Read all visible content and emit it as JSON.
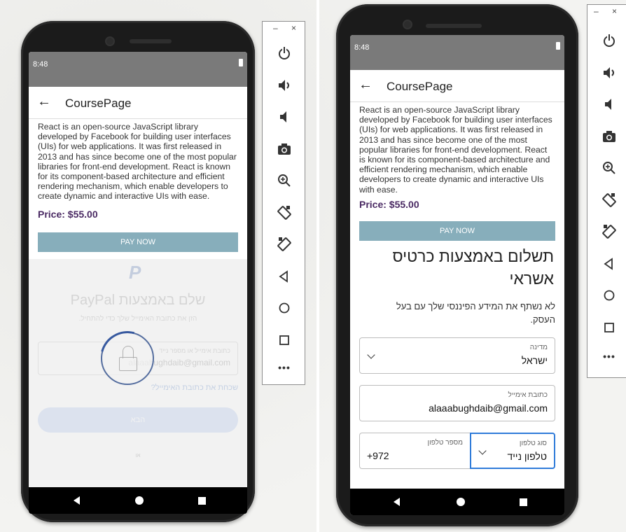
{
  "status": {
    "time": "8:48"
  },
  "appbar": {
    "back_glyph": "←",
    "title": "CoursePage"
  },
  "course": {
    "description": "React is an open-source JavaScript library developed by Facebook for building user interfaces (UIs) for web applications. It was first released in 2013 and has since become one of the most popular libraries for front-end development. React is known for its component-based architecture and efficient rendering mechanism, which enable developers to create dynamic and interactive UIs with ease.",
    "price": "Price: $55.00",
    "pay_button": "PAY NOW"
  },
  "paypal": {
    "logo": "P",
    "title": "שלם באמצעות PayPal",
    "subtitle": "הזן את כתובת האימייל שלך כדי להתחיל.",
    "email_label": "כתובת אימייל או מספר נייד",
    "email_value": "alaaabughdaib@gmail.com",
    "forgot_link": "שכחת את כתובת האימייל?",
    "next_button": "הבא",
    "or_text": "או"
  },
  "card_form": {
    "title": "תשלום באמצעות כרטיס אשראי",
    "note": "לא נשתף את המידע הפיננסי שלך עם בעל העסק.",
    "country_label": "מדינה",
    "country_value": "ישראל",
    "email_label": "כתובת אימייל",
    "email_value": "alaaabughdaib@gmail.com",
    "phone_type_label": "סוג טלפון",
    "phone_type_value": "טלפון נייד",
    "phone_number_label": "מספר טלפון",
    "phone_number_value": "+972"
  },
  "emulator_panel": {
    "window_controls": "– ×",
    "more_label": "•••",
    "buttons": [
      "power-icon",
      "volume-up-icon",
      "volume-down-icon",
      "camera-icon",
      "zoom-icon",
      "rotate-left-icon",
      "rotate-right-icon",
      "back-icon",
      "home-icon",
      "overview-icon"
    ]
  },
  "colors": {
    "accent": "#87aebb",
    "price": "#4a2a63",
    "focus": "#2f7bd9"
  }
}
